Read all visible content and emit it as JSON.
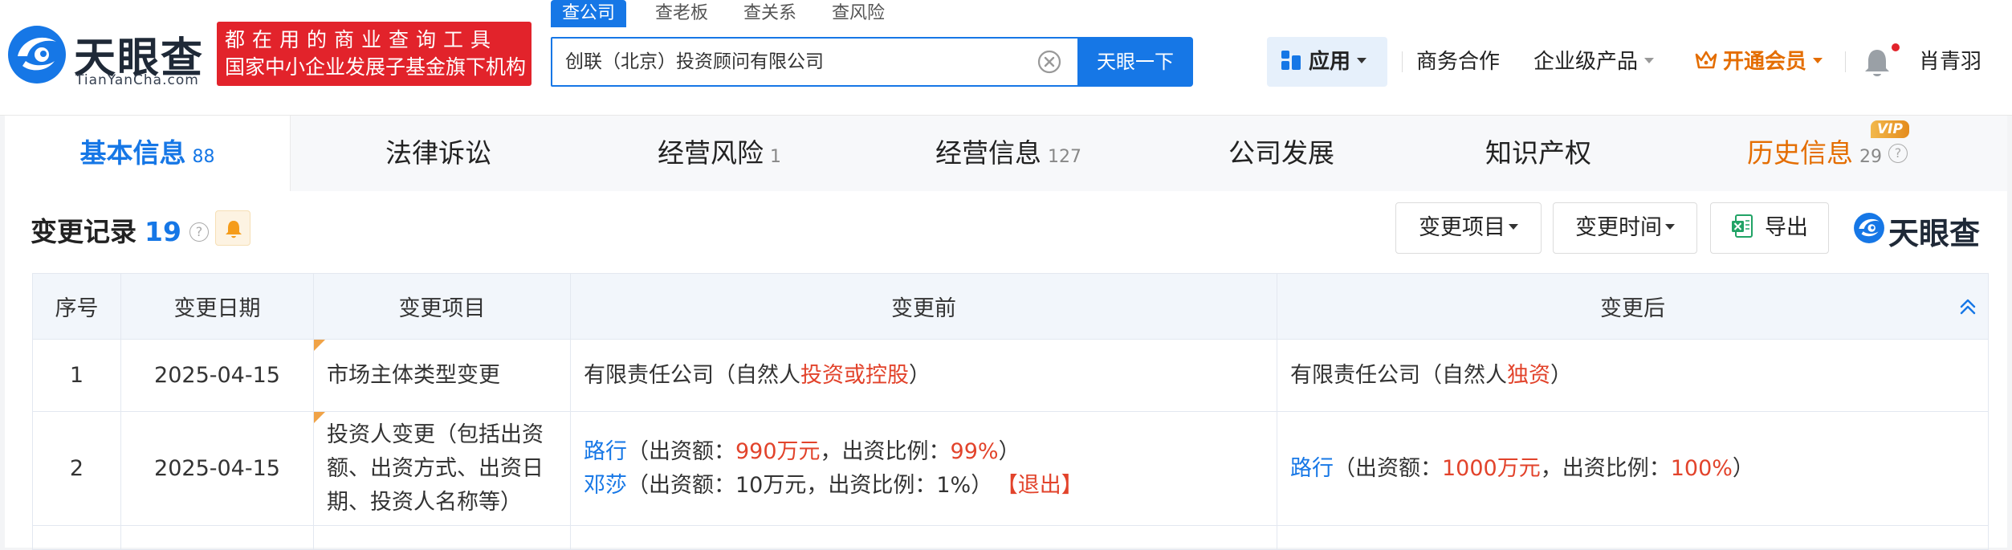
{
  "header": {
    "logo_cn": "天眼查",
    "logo_en": "TianYanCha.com",
    "slogan_line1": "都在用的商业查询工具",
    "slogan_line2": "国家中小企业发展子基金旗下机构",
    "search_tabs": [
      "查公司",
      "查老板",
      "查关系",
      "查风险"
    ],
    "search_value": "创联（北京）投资顾问有限公司",
    "search_button": "天眼一下",
    "nav": {
      "apps": "应用",
      "business": "商务合作",
      "enterprise": "企业级产品",
      "vip": "开通会员",
      "user": "肖青羽"
    }
  },
  "sections": [
    {
      "label": "基本信息",
      "count": "88"
    },
    {
      "label": "法律诉讼",
      "count": ""
    },
    {
      "label": "经营风险",
      "count": "1"
    },
    {
      "label": "经营信息",
      "count": "127"
    },
    {
      "label": "公司发展",
      "count": ""
    },
    {
      "label": "知识产权",
      "count": ""
    },
    {
      "label": "历史信息",
      "count": "29"
    }
  ],
  "vip_badge": "VIP",
  "help_glyph": "?",
  "content": {
    "title": "变更记录",
    "count": "19",
    "filter_item": "变更项目",
    "filter_time": "变更时间",
    "export": "导出",
    "brand": "天眼查"
  },
  "table": {
    "headers": [
      "序号",
      "变更日期",
      "变更项目",
      "变更前",
      "变更后"
    ],
    "rows": [
      {
        "no": "1",
        "date": "2025-04-15",
        "item": "市场主体类型变更",
        "before": {
          "pre": "有限责任公司（自然人",
          "hl": "投资或控股",
          "post": "）"
        },
        "after": {
          "pre": "有限责任公司（自然人",
          "hl": "独资",
          "post": "）"
        }
      },
      {
        "no": "2",
        "date": "2025-04-15",
        "item": "投资人变更（包括出资额、出资方式、出资日期、投资人名称等）",
        "before": [
          {
            "name": "路行",
            "t1": "（出资额：",
            "amount": "990万元",
            "t2": "，出资比例：",
            "ratio": "99%",
            "t3": "）"
          },
          {
            "name": "邓莎",
            "t1": "（出资额：10万元，出资比例：1%）",
            "tag": "【退出】"
          }
        ],
        "after": {
          "name": "路行",
          "t1": "（出资额：",
          "amount": "1000万元",
          "t2": "，出资比例：",
          "ratio": "100%",
          "t3": "）"
        }
      }
    ]
  },
  "colors": {
    "primary_blue": "#1677e6",
    "brand_red": "#e2232b",
    "vip_orange": "#e46d00",
    "highlight_red": "#e2432b"
  }
}
